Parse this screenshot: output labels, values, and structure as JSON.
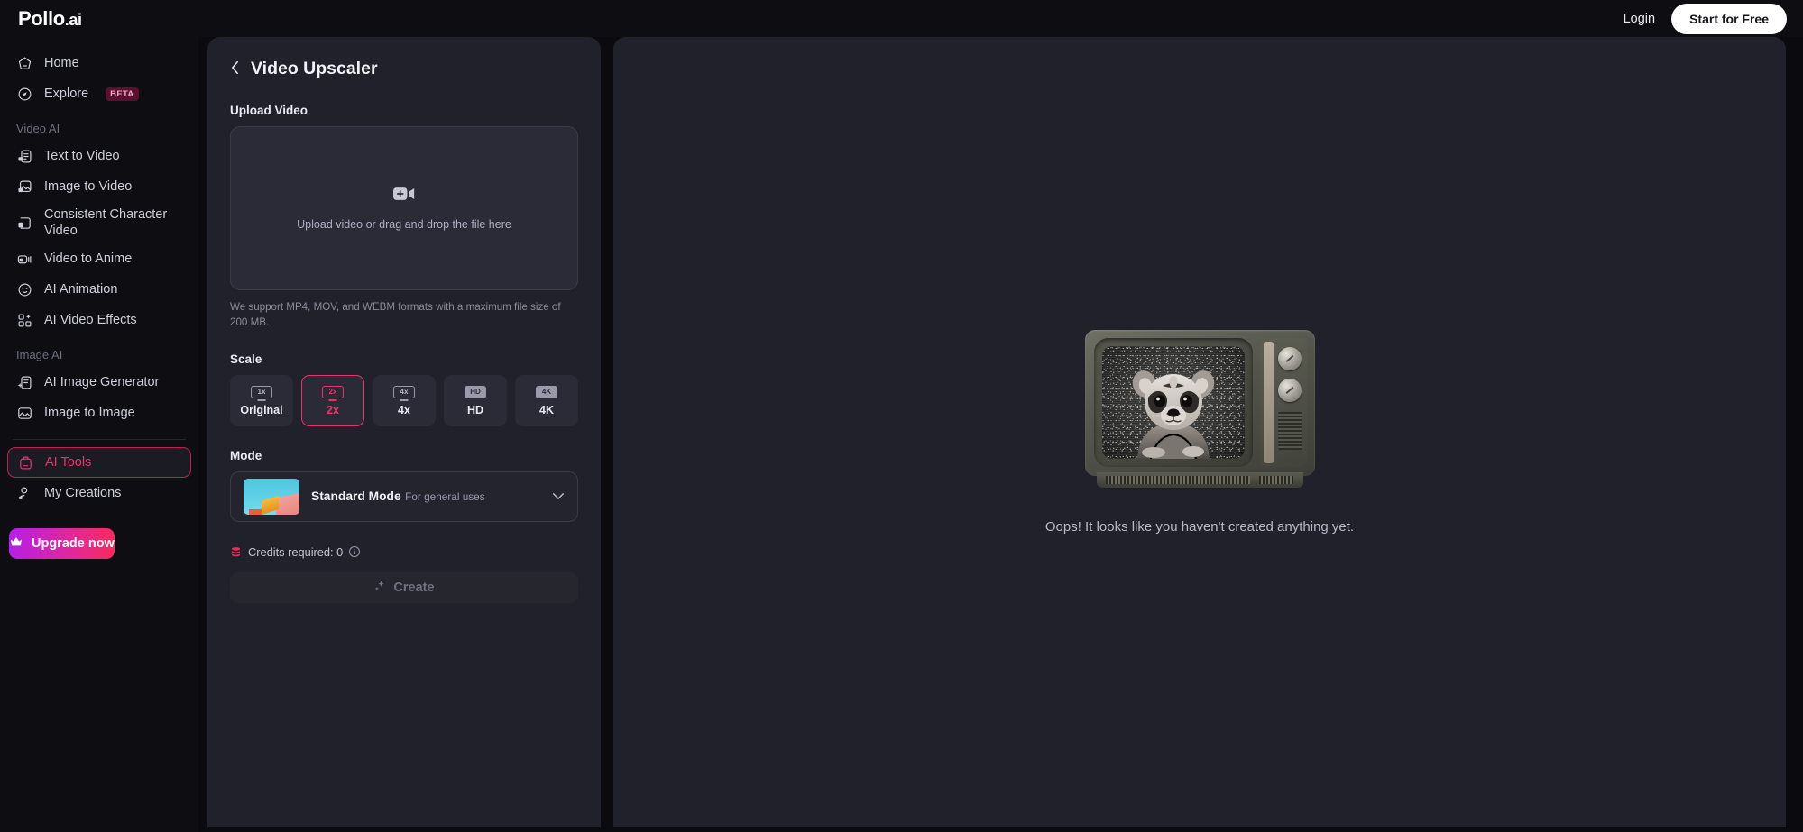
{
  "brand": {
    "name": "Pollo",
    "suffix": ".ai"
  },
  "topbar": {
    "login_label": "Login",
    "start_free_label": "Start for Free"
  },
  "sidebar": {
    "primary": [
      {
        "label": "Home",
        "icon": "home-icon"
      },
      {
        "label": "Explore",
        "icon": "compass-icon",
        "badge": "BETA"
      }
    ],
    "groups": [
      {
        "title": "Video AI",
        "items": [
          {
            "label": "Text to Video",
            "icon": "text-to-video-icon"
          },
          {
            "label": "Image to Video",
            "icon": "image-to-video-icon"
          },
          {
            "label": "Consistent Character Video",
            "icon": "consistent-character-icon"
          },
          {
            "label": "Video to Anime",
            "icon": "video-to-anime-icon"
          },
          {
            "label": "AI Animation",
            "icon": "ai-animation-icon"
          },
          {
            "label": "AI Video Effects",
            "icon": "ai-video-effects-icon"
          }
        ]
      },
      {
        "title": "Image AI",
        "items": [
          {
            "label": "AI Image Generator",
            "icon": "ai-image-generator-icon"
          },
          {
            "label": "Image to Image",
            "icon": "image-to-image-icon"
          }
        ]
      }
    ],
    "tools": [
      {
        "label": "AI Tools",
        "icon": "toolbox-icon",
        "active": true
      },
      {
        "label": "My Creations",
        "icon": "user-icon",
        "active": false
      }
    ],
    "upgrade_label": "Upgrade now",
    "upgrade_icon": "crown-icon"
  },
  "config_panel": {
    "back_icon": "chevron-left-icon",
    "title": "Video Upscaler",
    "upload": {
      "label": "Upload Video",
      "icon": "video-plus-icon",
      "dropzone_text": "Upload video or drag and drop the file here",
      "hint": "We support MP4, MOV, and WEBM formats with a maximum file size of 200 MB."
    },
    "scale": {
      "label": "Scale",
      "options": [
        {
          "name": "Original",
          "badge": "1x",
          "selected": false,
          "filled": false
        },
        {
          "name": "2x",
          "badge": "2x",
          "selected": true,
          "filled": false
        },
        {
          "name": "4x",
          "badge": "4x",
          "selected": false,
          "filled": false
        },
        {
          "name": "HD",
          "badge": "HD",
          "selected": false,
          "filled": true
        },
        {
          "name": "4K",
          "badge": "4K",
          "selected": false,
          "filled": true
        }
      ]
    },
    "mode": {
      "label": "Mode",
      "selected_name": "Standard Mode",
      "selected_desc": "For general uses",
      "caret_icon": "chevron-down-icon"
    },
    "credits": {
      "coin_icon": "credits-coin-icon",
      "text": "Credits required: 0",
      "info_icon": "info-icon",
      "info_glyph": "i"
    },
    "create": {
      "label": "Create",
      "icon": "sparkle-icon",
      "disabled": true
    }
  },
  "canvas": {
    "illustration": "retro-tv-raccoon-illustration",
    "empty_text": "Oops! It looks like you haven't created anything yet."
  },
  "colors": {
    "page_bg": "#0b0b0f",
    "sidebar_bg": "#0e0e12",
    "panel_bg": "#21212c",
    "accent_pink": "#e8336b",
    "upgrade_gradient_start": "#b51fe6",
    "upgrade_gradient_end": "#fa2a5e",
    "beta_badge_bg": "#5a1030"
  }
}
